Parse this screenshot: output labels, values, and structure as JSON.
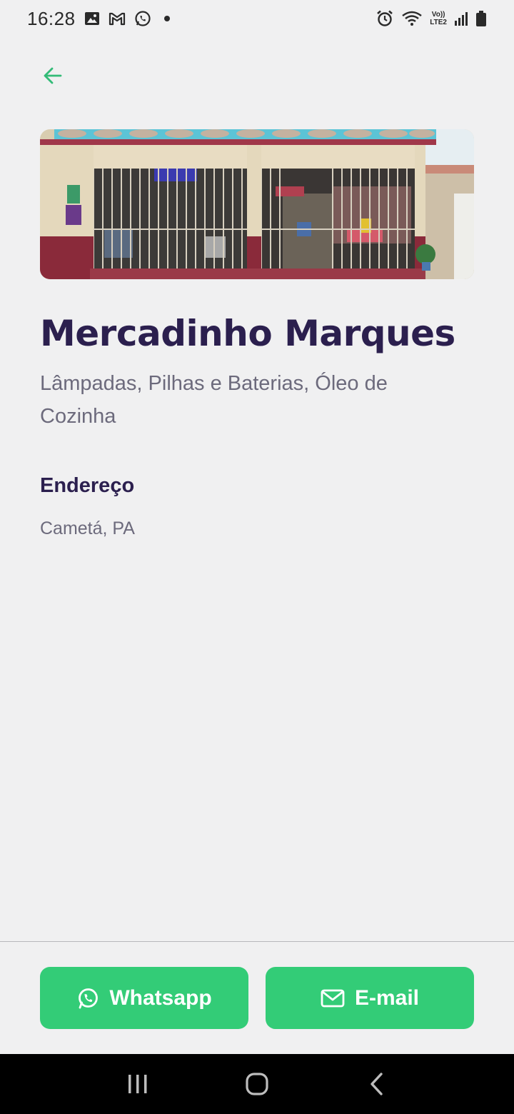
{
  "status_bar": {
    "time": "16:28",
    "left_icons": [
      "image-icon",
      "gmail-icon",
      "whatsapp-icon",
      "dot-icon"
    ],
    "right_icons": [
      "alarm-icon",
      "wifi-icon",
      "volte-icon",
      "signal-icon",
      "battery-icon"
    ],
    "volte_text": "Vo))",
    "lte_text": "LTE2"
  },
  "header": {
    "back_icon": "arrow-left-icon"
  },
  "store": {
    "name": "Mercadinho Marques",
    "categories": "Lâmpadas, Pilhas e Baterias, Óleo de Cozinha",
    "address_label": "Endereço",
    "address": "Cametá, PA"
  },
  "actions": {
    "whatsapp_label": "Whatsapp",
    "email_label": "E-mail"
  },
  "colors": {
    "accent": "#33cc77",
    "title": "#2b1f4e",
    "muted": "#6c6a7c",
    "background": "#f0f0f1"
  },
  "nav": {
    "recents_icon": "recents-icon",
    "home_icon": "home-icon",
    "back_icon": "back-chevron-icon"
  }
}
